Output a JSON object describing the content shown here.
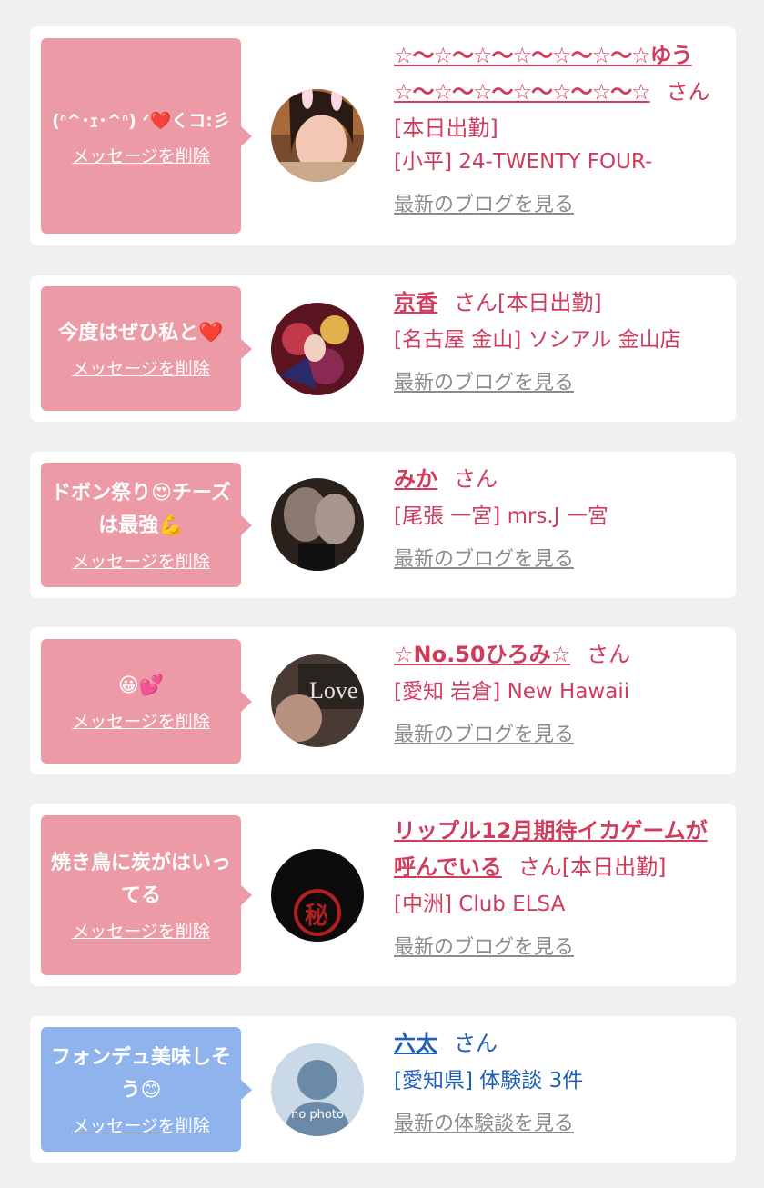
{
  "colors": {
    "pink_bubble": "#ec9aa6",
    "blue_bubble": "#8fb3ec",
    "pink_text": "#cf3c5c",
    "blue_text": "#1f5fb5",
    "link_gray": "#8c8c8c"
  },
  "items": [
    {
      "message": "(ᐢ^･ｪ･^ᐢ) ᐟ❤️くコ:彡",
      "delete_label": "メッセージを削除",
      "name": "☆〜☆〜☆〜☆〜☆〜☆〜☆ゆう☆〜☆〜☆〜☆〜☆〜☆〜☆",
      "suffix": "さん[本日出勤]",
      "shop": "[小平] 24-TWENTY FOUR-",
      "link": "最新のブログを見る"
    },
    {
      "message": "今度はぜひ私と❤️",
      "delete_label": "メッセージを削除",
      "name": "京香",
      "suffix": "さん[本日出勤]",
      "shop": "[名古屋 金山] ソシアル 金山店",
      "link": "最新のブログを見る"
    },
    {
      "message": "ドボン祭り😍チーズは最強💪",
      "delete_label": "メッセージを削除",
      "name": "みか",
      "suffix": "さん",
      "shop": "[尾張 一宮] mrs.J 一宮",
      "link": "最新のブログを見る"
    },
    {
      "message": "😀💕",
      "delete_label": "メッセージを削除",
      "name": "☆No.50ひろみ☆",
      "suffix": "さん",
      "shop": "[愛知 岩倉] New Hawaii",
      "link": "最新のブログを見る"
    },
    {
      "message": "焼き鳥に炭がはいってる",
      "delete_label": "メッセージを削除",
      "name": "リップル12月期待イカゲームが呼んでいる",
      "suffix": "さん[本日出勤]",
      "shop": "[中洲] Club ELSA",
      "link": "最新のブログを見る"
    },
    {
      "message": "フォンデュ美味しそう😊",
      "delete_label": "メッセージを削除",
      "name": "六太",
      "suffix": "さん",
      "shop": "[愛知県] 体験談 3件",
      "link": "最新の体験談を見る",
      "avatar_text": "no photo"
    }
  ]
}
